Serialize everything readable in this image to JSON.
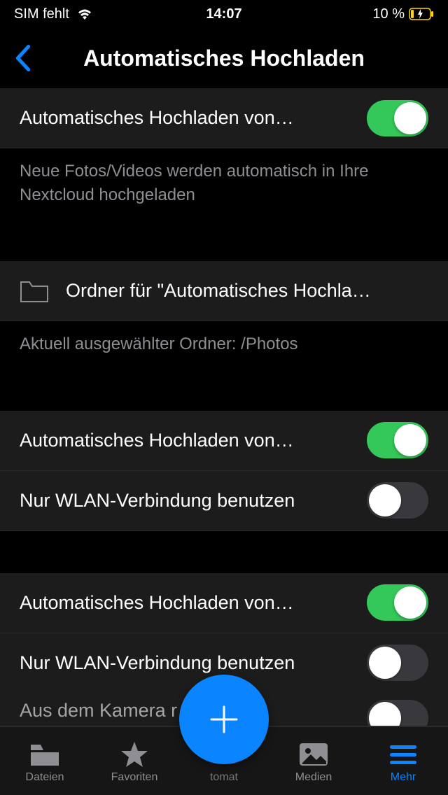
{
  "status": {
    "carrier": "SIM fehlt",
    "time": "14:07",
    "battery_pct": "10 %"
  },
  "nav": {
    "title": "Automatisches Hochladen"
  },
  "section1": {
    "row1_label": "Automatisches Hochladen von…",
    "row1_on": true,
    "footer": "Neue Fotos/Videos werden automatisch in Ihre Nextcloud hochgeladen"
  },
  "section2": {
    "row1_label": "Ordner für \"Automatisches Hochla…",
    "footer": "Aktuell ausgewählter Ordner: /Photos"
  },
  "section3": {
    "row1_label": "Automatisches Hochladen von…",
    "row1_on": true,
    "row2_label": "Nur WLAN-Verbindung benutzen",
    "row2_on": false
  },
  "section4": {
    "row1_label": "Automatisches Hochladen von…",
    "row1_on": true,
    "row2_label": "Nur WLAN-Verbindung benutzen",
    "row2_on": false
  },
  "section5": {
    "row1_label_partial": "Aus dem Kamera            r lösch"
  },
  "tabbar": {
    "files": "Dateien",
    "favorites": "Favoriten",
    "center_ghost": "tomat",
    "media": "Medien",
    "more": "Mehr"
  }
}
